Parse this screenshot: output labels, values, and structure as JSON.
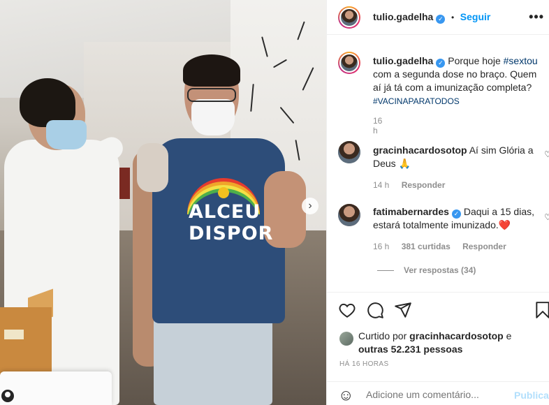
{
  "post": {
    "author": "tulio.gadelha",
    "follow_label": "Seguir",
    "more_label": "•••",
    "dot": "•",
    "verified_mark": "✓",
    "caption_before": "Porque hoje ",
    "caption_hashtag": "#sextou",
    "caption_after": " com a segunda dose no braço. Quem aí já tá com a imunização completa?",
    "caption_tag2": "#VACINAPARATODOS",
    "caption_time": "16 h"
  },
  "photo": {
    "shirt_line1": "ALCEU",
    "shirt_line2": "DISPOR",
    "next_icon": "›"
  },
  "comments": [
    {
      "user": "gracinhacardosotop",
      "text": "Aí sim Glória a Deus 🙏",
      "time": "14 h",
      "reply_label": "Responder",
      "like_icon": "♡"
    },
    {
      "user": "fatimabernardes",
      "text": "Daqui a 15 dias, estará totalmente imunizado.",
      "heart": "❤️",
      "time": "16 h",
      "likes": "381 curtidas",
      "reply_label": "Responder",
      "view_replies": "Ver respostas (34)",
      "like_icon": "♡"
    }
  ],
  "likes": {
    "prefix": "Curtido por ",
    "user": "gracinhacardosotop",
    "and": " e",
    "others": "outras 52.231 pessoas"
  },
  "timestamp": "HÁ 16 HORAS",
  "comment_box": {
    "emoji_icon": "☺",
    "placeholder": "Adicione um comentário...",
    "publish_label": "Publicar"
  },
  "colors": {
    "accent": "#0095f6",
    "verified": "#3897f0",
    "heart_red": "#ed4956"
  }
}
